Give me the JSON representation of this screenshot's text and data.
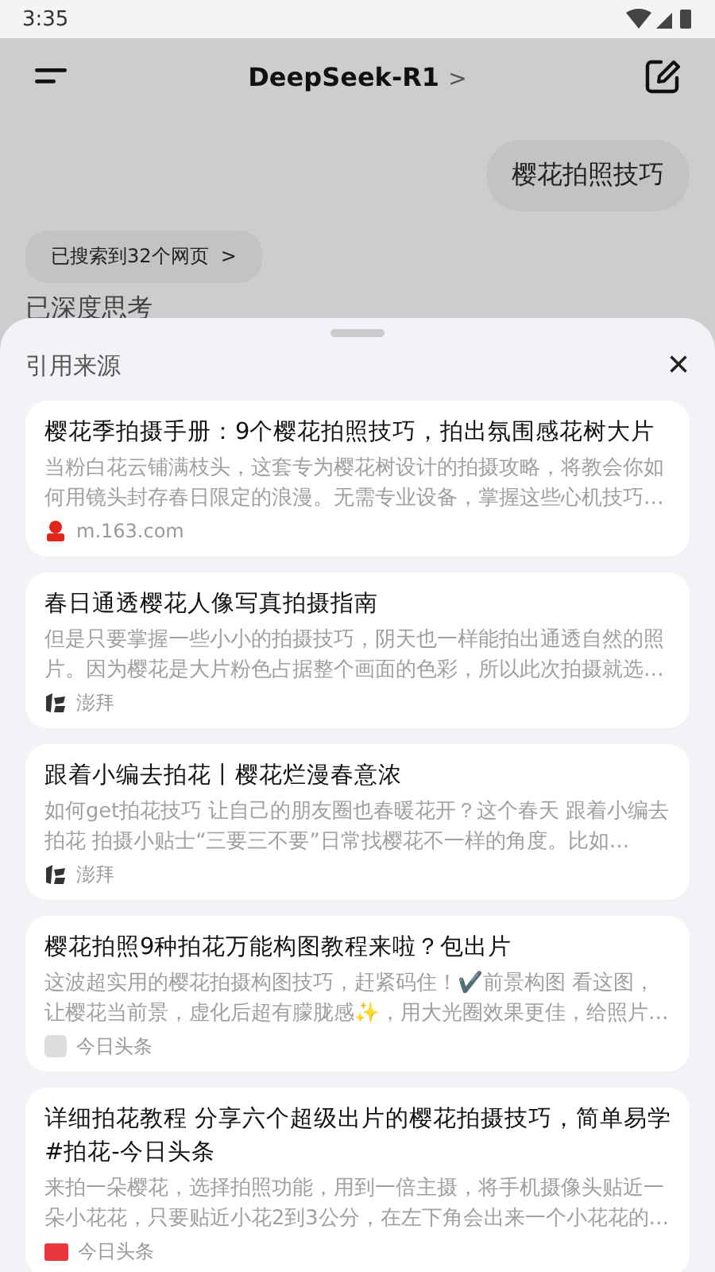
{
  "status_bar": {
    "time": "3:35"
  },
  "header": {
    "title": "DeepSeek-R1",
    "chevron": ">"
  },
  "chat": {
    "user_message": "樱花拍照技巧",
    "search_chip": "已搜索到32个网页",
    "chip_chevron": ">",
    "thinking": "已深度思考"
  },
  "sheet": {
    "title": "引用来源",
    "close": "×",
    "sources": [
      {
        "title": "樱花季拍摄手册：9个樱花拍照技巧，拍出氛围感花树大片",
        "snippet": "当粉白花云铺满枝头，这套专为樱花树设计的拍摄攻略，将教会你如何用镜头封存春日限定的浪漫。无需专业设备，掌握这些心机技巧…",
        "site": "m.163.com",
        "kind": "netease"
      },
      {
        "title": "春日通透樱花人像写真拍摄指南",
        "snippet": "但是只要掌握一些小小的拍摄技巧，阴天也一样能拍出通透自然的照片。因为樱花是大片粉色占据整个画面的色彩，所以此次拍摄就选…",
        "site": "澎拜",
        "kind": "pengpai"
      },
      {
        "title": "跟着小编去拍花丨樱花烂漫春意浓",
        "snippet": "如何get拍花技巧 让自己的朋友圈也春暖花开？这个春天 跟着小编去拍花 拍摄小贴士“三要三不要”日常找樱花不一样的角度。比如…",
        "site": "澎拜",
        "kind": "pengpai"
      },
      {
        "title": "樱花拍照9种拍花万能构图教程来啦？包出片",
        "snippet": "这波超实用的樱花拍摄构图技巧，赶紧码住！✔️前景构图 看这图，让樱花当前景，虚化后超有朦胧感✨，用大光圈效果更佳，给照片…",
        "site": "今日头条",
        "kind": "placeholder"
      },
      {
        "title": "详细拍花教程 分享六个超级出片的樱花拍摄技巧，简单易学#拍花-今日头条",
        "snippet": "来拍一朵樱花，选择拍照功能，用到一倍主摄，将手机摄像头贴近一朵小花花，只要贴近小花2到3公分，在左下角会出来一个小花花的…",
        "site": "今日头条",
        "kind": "toutiao"
      }
    ]
  }
}
